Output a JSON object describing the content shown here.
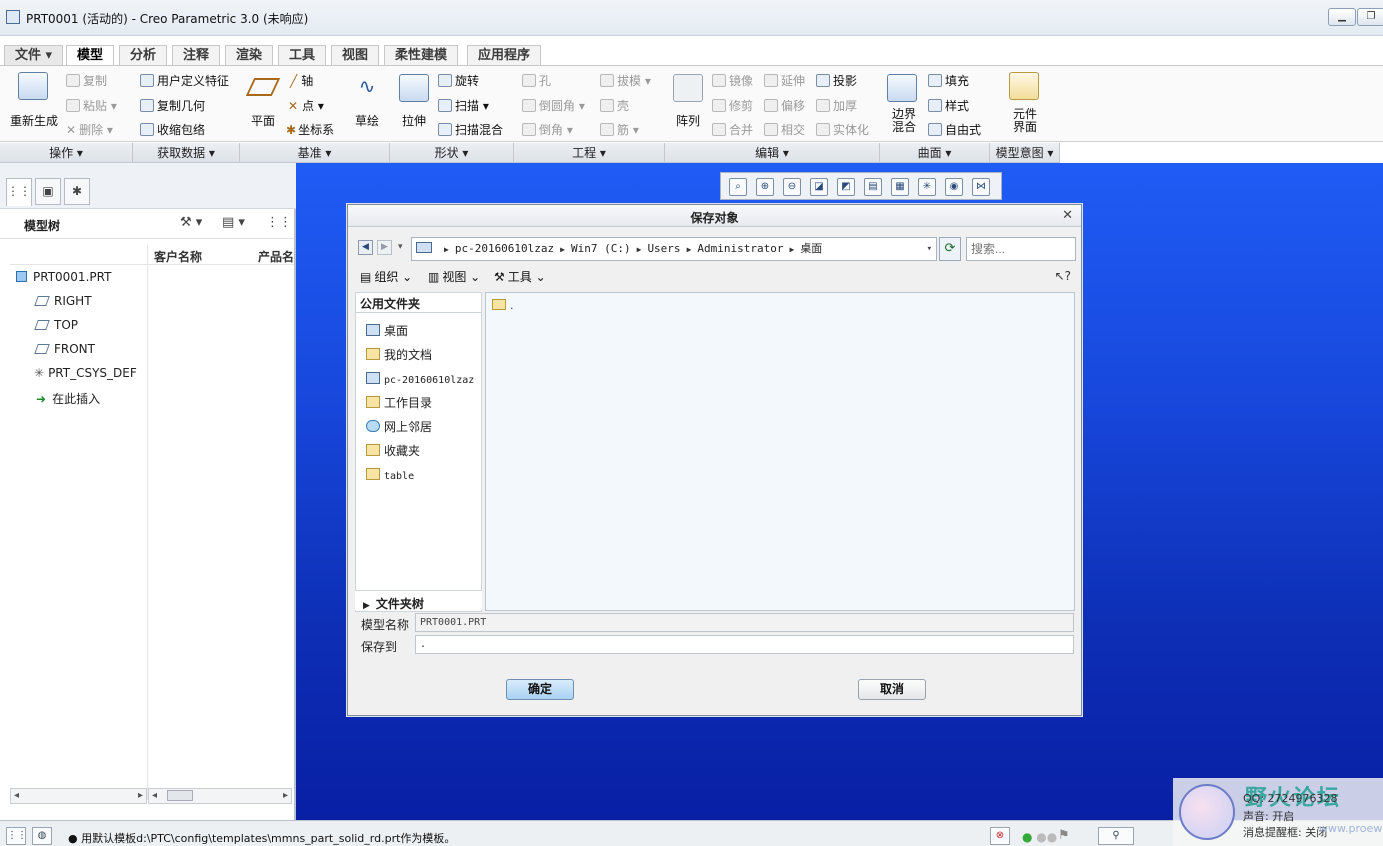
{
  "window": {
    "title": "PRT0001 (活动的) - Creo Parametric 3.0 (未响应)"
  },
  "menu_tabs": [
    "文件",
    "模型",
    "分析",
    "注释",
    "渲染",
    "工具",
    "视图",
    "柔性建模",
    "应用程序"
  ],
  "ribbon": {
    "operations": {
      "regenerate": "重新生成",
      "copy": "复制",
      "paste": "粘贴",
      "delete": "删除"
    },
    "get_data": {
      "udf": "用户定义特征",
      "copy_geom": "复制几何",
      "shrinkwrap": "收缩包络"
    },
    "datum": {
      "plane": "平面",
      "axis": "轴",
      "point": "点",
      "csys": "坐标系",
      "sketch": "草绘"
    },
    "shapes": {
      "extrude": "拉伸",
      "revolve": "旋转",
      "sweep": "扫描",
      "swept_blend": "扫描混合"
    },
    "engineering": {
      "hole": "孔",
      "round": "倒圆角",
      "chamfer": "倒角",
      "draft": "拔模",
      "shell": "壳",
      "rib": "筋"
    },
    "editing": {
      "pattern": "阵列",
      "mirror": "镜像",
      "trim": "修剪",
      "merge": "合并",
      "extend": "延伸",
      "offset": "偏移",
      "intersect": "相交",
      "project": "投影",
      "thicken": "加厚",
      "solidify": "实体化"
    },
    "surfaces": {
      "boundary_blend": "边界混合",
      "fill": "填充",
      "style": "样式",
      "freestyle": "自由式"
    },
    "model_intent": {
      "component_interface": "元件界面"
    },
    "groups": [
      "操作",
      "获取数据",
      "基准",
      "形状",
      "工程",
      "编辑",
      "曲面",
      "模型意图"
    ]
  },
  "model_tree": {
    "title": "模型树",
    "columns": [
      "客户名称",
      "产品名"
    ],
    "items": [
      "PRT0001.PRT",
      "RIGHT",
      "TOP",
      "FRONT",
      "PRT_CSYS_DEF",
      "在此插入"
    ]
  },
  "dialog": {
    "title": "保存对象",
    "path": [
      "pc-20160610lzaz",
      "Win7 (C:)",
      "Users",
      "Administrator",
      "桌面"
    ],
    "search_placeholder": "搜索...",
    "toolbar": {
      "organize": "组织",
      "views": "视图",
      "tools": "工具"
    },
    "places_header": "公用文件夹",
    "places": [
      "桌面",
      "我的文档",
      "pc-20160610lzaz",
      "工作目录",
      "网上邻居",
      "收藏夹",
      "table"
    ],
    "folder_tree_label": "文件夹树",
    "files": [
      "."
    ],
    "model_name_label": "模型名称",
    "model_name_value": "PRT0001.PRT",
    "save_to_label": "保存到",
    "save_to_value": ".",
    "ok_label": "确定",
    "cancel_label": "取消"
  },
  "status": {
    "message": "● 用默认模板d:\\PTC\\config\\templates\\mmns_part_solid_rd.prt作为模板。"
  },
  "watermark": {
    "site": "野火论坛",
    "qq": "QQ: 2724976328",
    "sound": "声音: 开启",
    "reminder": "消息提醒框: 关闭",
    "url": "www.proewildfire.cn"
  }
}
